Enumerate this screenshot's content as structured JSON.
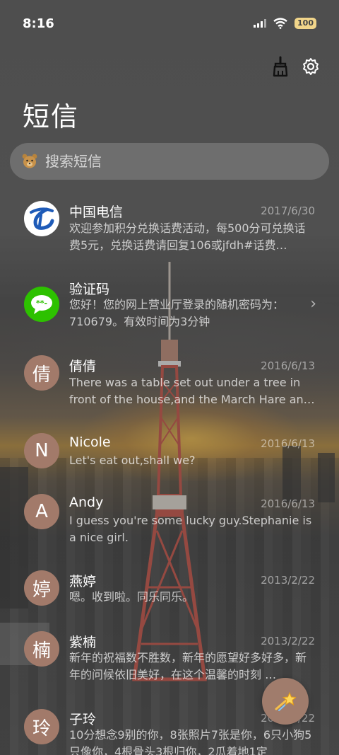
{
  "status_bar": {
    "time": "8:16",
    "battery": "100"
  },
  "header": {
    "title": "短信",
    "clean_icon": "broom-icon",
    "settings_icon": "gear-icon"
  },
  "search": {
    "placeholder": "搜索短信",
    "icon": "bear-icon"
  },
  "conversations": [
    {
      "name": "中国电信",
      "date": "2017/6/30",
      "preview": "欢迎参加积分兑换话费活动，每500分可兑换话费5元，兑换话费请回复106或jfdh#话费…",
      "avatar": "telecom-logo"
    },
    {
      "name": "验证码",
      "date": "",
      "preview": "您好！您的网上营业厅登录的随机密码为：710679。有效时间为3分钟",
      "avatar": "sms-bubble-icon"
    },
    {
      "name": "倩倩",
      "date": "2016/6/13",
      "preview": "There was a table set out under a tree in front of the house,and the March Hare an…",
      "avatar_letter": "倩"
    },
    {
      "name": "Nicole",
      "date": "2016/6/13",
      "preview": "Let's eat out,shall we?",
      "avatar_letter": "N"
    },
    {
      "name": "Andy",
      "date": "2016/6/13",
      "preview": "I guess you're some lucky guy.Stephanie is a nice girl.",
      "avatar_letter": "A"
    },
    {
      "name": "燕婷",
      "date": "2013/2/22",
      "preview": "嗯。收到啦。同乐同乐。",
      "avatar_letter": "婷"
    },
    {
      "name": "紫楠",
      "date": "2013/2/22",
      "preview": "新年的祝福数不胜数，新年的愿望好多好多，新年的问候依旧美好，在这个温馨的时刻 …",
      "avatar_letter": "楠"
    },
    {
      "name": "子玲",
      "date": "2013/2/22",
      "preview": "10分想念9别的你，8张照片7张是你，6只小狗5只像你，4根骨头3根归你，2瓜着地1定",
      "avatar_letter": "玲"
    }
  ],
  "fab": {
    "icon": "shooting-star-icon"
  },
  "colors": {
    "avatar_bg": "#a27a6a",
    "battery_bg": "#f1d58a",
    "telecom_blue": "#1e5bb8",
    "wechat_green": "#2dc100"
  }
}
